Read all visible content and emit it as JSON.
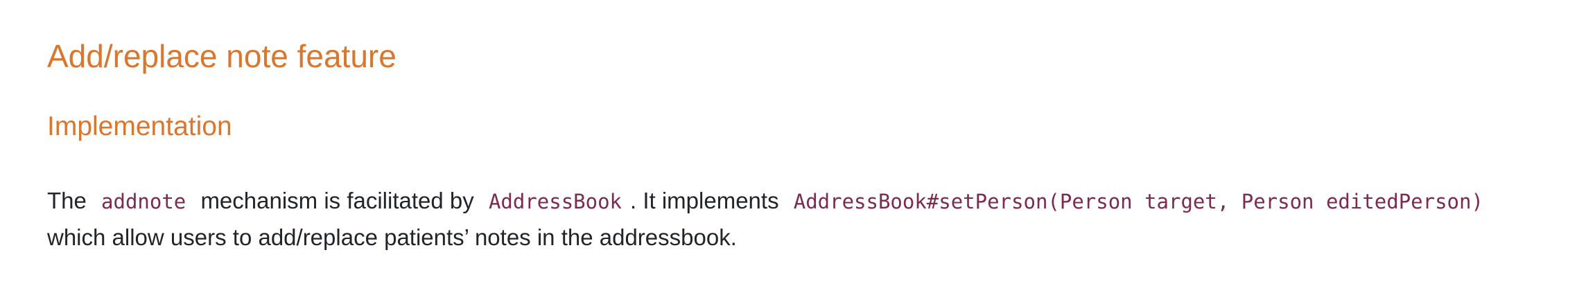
{
  "heading": "Add/replace note feature",
  "subheading": "Implementation",
  "paragraph": {
    "t1": "The",
    "code1": "addnote",
    "t2": "mechanism is facilitated by",
    "code2": "AddressBook",
    "t3": ". It implements",
    "code3": "AddressBook#setPerson(Person target, Person editedPerson)",
    "line2": "which allow users to add/replace patients’ notes in the addressbook."
  },
  "colors": {
    "heading": "#d9762f",
    "code": "#7b2a50",
    "text": "#212529"
  }
}
